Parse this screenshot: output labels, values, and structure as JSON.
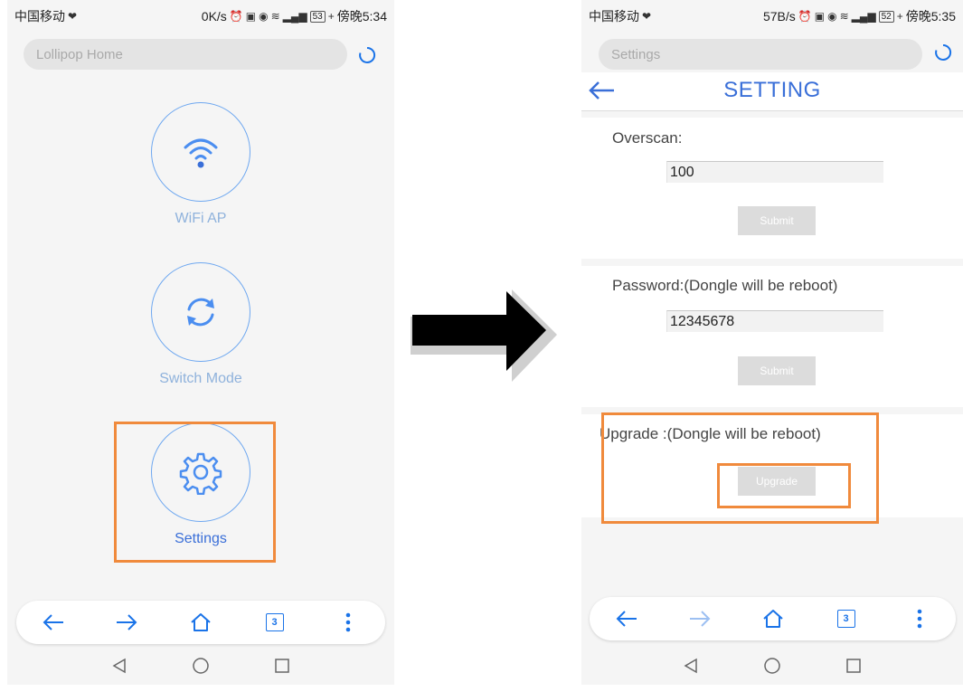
{
  "left_screen": {
    "status": {
      "carrier": "中国移动",
      "speed": "0K/s",
      "battery": "53",
      "time": "傍晚5:34"
    },
    "url": {
      "text": "Lollipop Home"
    },
    "menu": {
      "wifi": {
        "label": "WiFi AP",
        "icon": "wifi-icon"
      },
      "switch": {
        "label": "Switch Mode",
        "icon": "sync-icon"
      },
      "settings": {
        "label": "Settings",
        "icon": "gear-icon"
      }
    },
    "tab_count": "3"
  },
  "right_screen": {
    "status": {
      "carrier": "中国移动",
      "speed": "57B/s",
      "battery": "52",
      "time": "傍晚5:35"
    },
    "url": {
      "text": "Settings"
    },
    "title": "SETTING",
    "overscan": {
      "label": "Overscan:",
      "value": "100",
      "button": "Submit"
    },
    "password": {
      "label": "Password:(Dongle will be reboot)",
      "value": "12345678",
      "button": "Submit"
    },
    "upgrade": {
      "label": "Upgrade :(Dongle will be reboot)",
      "button": "Upgrade"
    },
    "tab_count": "3"
  },
  "colors": {
    "accent": "#1a73e8",
    "highlight": "#f08a3c",
    "title": "#3a6fd8"
  }
}
